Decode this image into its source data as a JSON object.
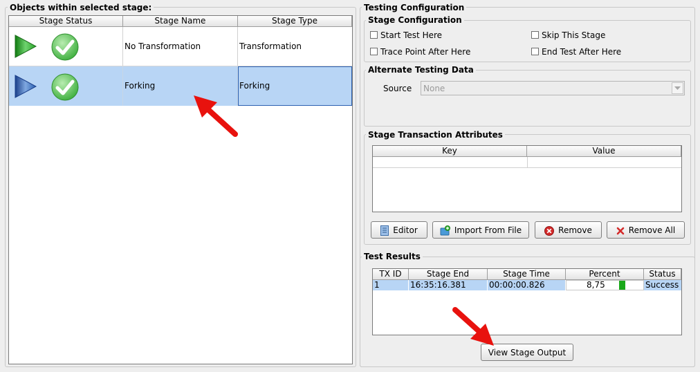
{
  "left_panel": {
    "title": "Objects within selected stage:",
    "columns": [
      "Stage Status",
      "Stage Name",
      "Stage Type"
    ],
    "rows": [
      {
        "name": "No Transformation",
        "type": "Transformation",
        "selected": false
      },
      {
        "name": "Forking",
        "type": "Forking",
        "selected": true
      }
    ]
  },
  "testing_config": {
    "title": "Testing Configuration",
    "stage_config": {
      "title": "Stage Configuration",
      "start_test_here": "Start Test Here",
      "skip_this_stage": "Skip This Stage",
      "trace_point_after_here": "Trace Point After Here",
      "end_test_after_here": "End Test After Here"
    },
    "alternate_data": {
      "title": "Alternate Testing Data",
      "source_label": "Source",
      "source_value": "None"
    },
    "transaction_attributes": {
      "title": "Stage Transaction Attributes",
      "columns": [
        "Key",
        "Value"
      ],
      "buttons": {
        "editor": "Editor",
        "import": "Import From File",
        "remove": "Remove",
        "remove_all": "Remove All"
      }
    },
    "test_results": {
      "title": "Test Results",
      "columns": [
        "TX ID",
        "Stage End",
        "Stage Time",
        "Percent",
        "Status"
      ],
      "rows": [
        {
          "tx_id": "1",
          "stage_end": "16:35:16.381",
          "stage_time": "00:00:00.826",
          "percent": "8,75",
          "status": "Success"
        }
      ],
      "view_output_button": "View Stage Output"
    }
  },
  "colors": {
    "selection": "#b8d5f5",
    "arrow": "#e8120e",
    "success_bar": "#19a819",
    "play_green": "#2aa52a",
    "play_blue": "#2a5fb0"
  }
}
